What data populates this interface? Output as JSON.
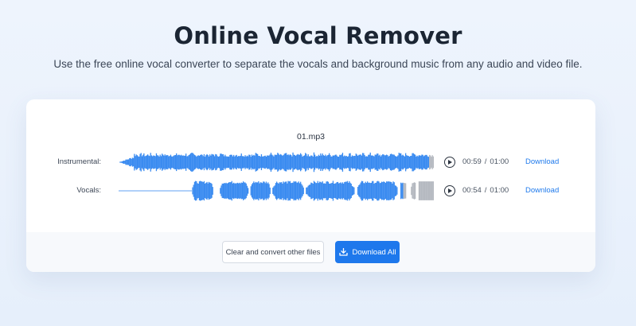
{
  "page": {
    "title": "Online Vocal Remover",
    "subtitle": "Use the free online vocal converter to separate the vocals and background music from any audio and video file."
  },
  "file": {
    "name": "01.mp3"
  },
  "tracks": [
    {
      "label": "Instrumental:",
      "current_time": "00:59",
      "separator": "/",
      "duration": "01:00",
      "download_label": "Download",
      "progress": 0.983,
      "play_icon": "play-icon"
    },
    {
      "label": "Vocals:",
      "current_time": "00:54",
      "separator": "/",
      "duration": "01:00",
      "download_label": "Download",
      "progress": 0.9,
      "play_icon": "play-icon"
    }
  ],
  "actions": {
    "clear_label": "Clear and convert other files",
    "download_all_label": "Download All",
    "download_all_icon": "download-icon"
  },
  "colors": {
    "accent": "#1e78ec",
    "wave_played": "#3a8bf0",
    "wave_unplayed": "#b5b9c0"
  }
}
